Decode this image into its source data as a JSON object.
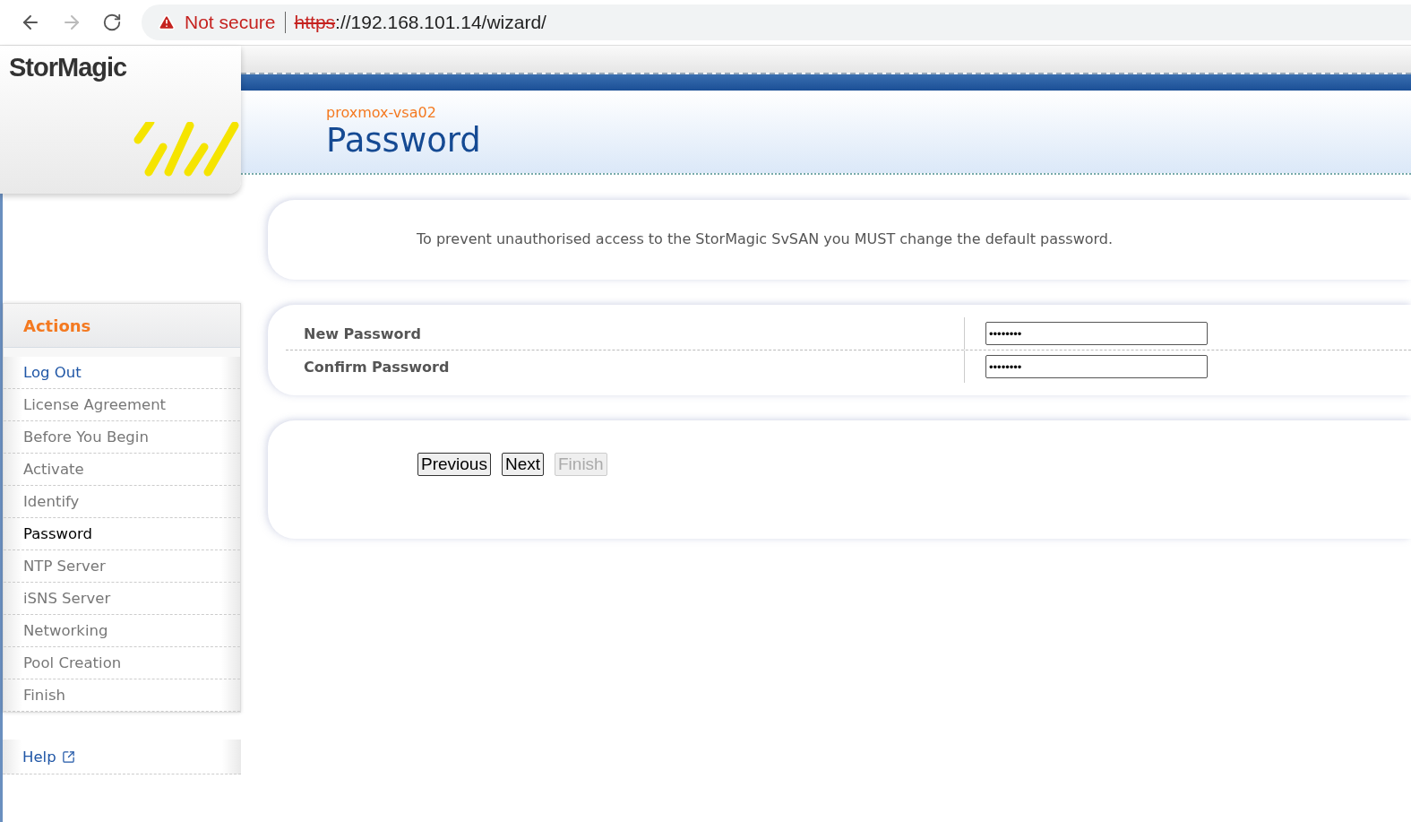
{
  "browser": {
    "security": "Not secure",
    "url_scheme": "https",
    "url_rest": "://192.168.101.14/wizard/"
  },
  "logo": "StorMagic",
  "header": {
    "host": "proxmox-vsa02",
    "title": "Password"
  },
  "sidebar": {
    "heading": "Actions",
    "items": [
      {
        "label": "Log Out",
        "kind": "link",
        "selected": false
      },
      {
        "label": "License Agreement",
        "kind": "step",
        "selected": false
      },
      {
        "label": "Before You Begin",
        "kind": "step",
        "selected": false
      },
      {
        "label": "Activate",
        "kind": "step",
        "selected": false
      },
      {
        "label": "Identify",
        "kind": "step",
        "selected": false
      },
      {
        "label": "Password",
        "kind": "step",
        "selected": true
      },
      {
        "label": "NTP Server",
        "kind": "step",
        "selected": false
      },
      {
        "label": "iSNS Server",
        "kind": "step",
        "selected": false
      },
      {
        "label": "Networking",
        "kind": "step",
        "selected": false
      },
      {
        "label": "Pool Creation",
        "kind": "step",
        "selected": false
      },
      {
        "label": "Finish",
        "kind": "step",
        "selected": false
      }
    ],
    "help": "Help"
  },
  "notice": "To prevent unauthorised access to the StorMagic SvSAN you MUST change the default password.",
  "fields": [
    {
      "label": "New Password",
      "value": "••••••••"
    },
    {
      "label": "Confirm Password",
      "value": "••••••••"
    }
  ],
  "buttons": [
    {
      "label": "Previous",
      "disabled": false
    },
    {
      "label": "Next",
      "disabled": false
    },
    {
      "label": "Finish",
      "disabled": true
    }
  ]
}
